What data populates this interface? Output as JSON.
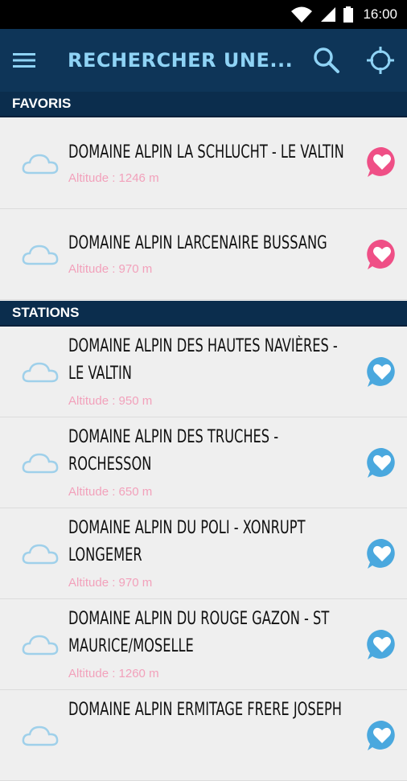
{
  "status": {
    "time": "16:00"
  },
  "app_bar": {
    "title": "RECHERCHER UNE..."
  },
  "sections": {
    "favorites": "FAVORIS",
    "stations": "STATIONS"
  },
  "favorites": [
    {
      "name": "DOMAINE ALPIN LA SCHLUCHT - LE VALTIN",
      "altitude": "Altitude : 1246 m",
      "favorite": true
    },
    {
      "name": "DOMAINE ALPIN LARCENAIRE BUSSANG",
      "altitude": "Altitude : 970 m",
      "favorite": true
    }
  ],
  "stations": [
    {
      "name_line1": "DOMAINE ALPIN DES HAUTES NAVIÈRES -",
      "name_line2": "LE VALTIN",
      "altitude": "Altitude : 950 m",
      "favorite": false
    },
    {
      "name_line1": "DOMAINE ALPIN DES TRUCHES -",
      "name_line2": "ROCHESSON",
      "altitude": "Altitude : 650 m",
      "favorite": false
    },
    {
      "name_line1": "DOMAINE ALPIN DU POLI - XONRUPT",
      "name_line2": "LONGEMER",
      "altitude": "Altitude : 970 m",
      "favorite": false
    },
    {
      "name_line1": "DOMAINE ALPIN DU ROUGE GAZON - ST",
      "name_line2": "MAURICE/MOSELLE",
      "altitude": "Altitude : 1260 m",
      "favorite": false
    },
    {
      "name_line1": "DOMAINE ALPIN ERMITAGE FRERE JOSEPH",
      "name_line2": "",
      "altitude": "",
      "favorite": false
    }
  ],
  "colors": {
    "app_bar": "#0e3558",
    "title": "#8fd3f5",
    "fav_on": "#ef4f86",
    "fav_off": "#4aa8de",
    "altitude": "#f2a1bb"
  },
  "icons": {
    "menu": "hamburger-icon",
    "search": "search-icon",
    "locate": "crosshair-icon",
    "weather": "cloud-icon",
    "favorite": "heart-icon"
  }
}
